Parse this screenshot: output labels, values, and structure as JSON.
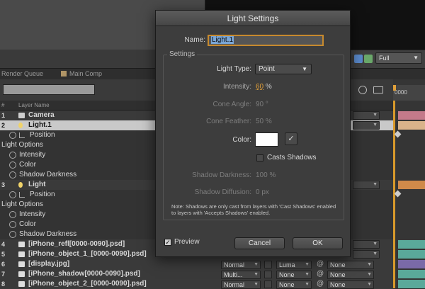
{
  "app": {
    "tabs": {
      "render_queue": "Render Queue",
      "main_comp": "Main Comp"
    },
    "comp_resolution": "Full",
    "ruler_label": "0000",
    "header": {
      "hash": "#",
      "layer_name": "Layer Name"
    }
  },
  "layers": [
    {
      "num": "1",
      "name": "Camera",
      "icon_color": "#cfcfcf"
    },
    {
      "num": "2",
      "name": "Light.1",
      "icon_color": "#f0d36a"
    },
    {
      "prop": "Position"
    },
    {
      "group": "Light Options"
    },
    {
      "prop": "Intensity"
    },
    {
      "prop": "Color"
    },
    {
      "prop": "Shadow Darkness"
    },
    {
      "num": "3",
      "name": "Light",
      "icon_color": "#f0d36a"
    },
    {
      "prop": "Position"
    },
    {
      "group": "Light Options"
    },
    {
      "prop": "Intensity"
    },
    {
      "prop": "Color"
    },
    {
      "prop": "Shadow Darkness"
    },
    {
      "num": "4",
      "name": "[iPhone_refl[0000-0090].psd]"
    },
    {
      "num": "5",
      "name": "[iPhone_object_1_[0000-0090].psd]"
    },
    {
      "num": "6",
      "name": "[display.jpg]"
    },
    {
      "num": "7",
      "name": "[iPhone_shadow[0000-0090].psd]"
    },
    {
      "num": "8",
      "name": "[iPhone_object_2_[0000-0090].psd]"
    }
  ],
  "mode_columns": {
    "row6": {
      "mode": "Normal",
      "trkmat": "Luma",
      "parent": "None"
    },
    "row7": {
      "mode": "Multi...",
      "trkmat": "None",
      "parent": "None"
    },
    "row8": {
      "mode": "Normal",
      "trkmat": "None",
      "parent": "None"
    }
  },
  "dialog": {
    "title": "Light Settings",
    "name_label": "Name:",
    "name_value": "Light.1",
    "settings_label": "Settings",
    "light_type_label": "Light Type:",
    "light_type_value": "Point",
    "intensity_label": "Intensity:",
    "intensity_value": "60",
    "intensity_unit": "%",
    "cone_angle_label": "Cone Angle:",
    "cone_angle_value": "90 °",
    "cone_feather_label": "Cone Feather:",
    "cone_feather_value": "50 %",
    "color_label": "Color:",
    "color_value": "#ffffff",
    "casts_shadows_label": "Casts Shadows",
    "shadow_darkness_label": "Shadow Darkness:",
    "shadow_darkness_value": "100 %",
    "shadow_diffusion_label": "Shadow Diffusion:",
    "shadow_diffusion_value": "0 px",
    "note": "Note: Shadows are only cast from layers with 'Cast Shadows' enabled to layers with 'Accepts Shadows' enabled.",
    "preview_label": "Preview",
    "preview_checked": true,
    "cancel_label": "Cancel",
    "ok_label": "OK"
  }
}
